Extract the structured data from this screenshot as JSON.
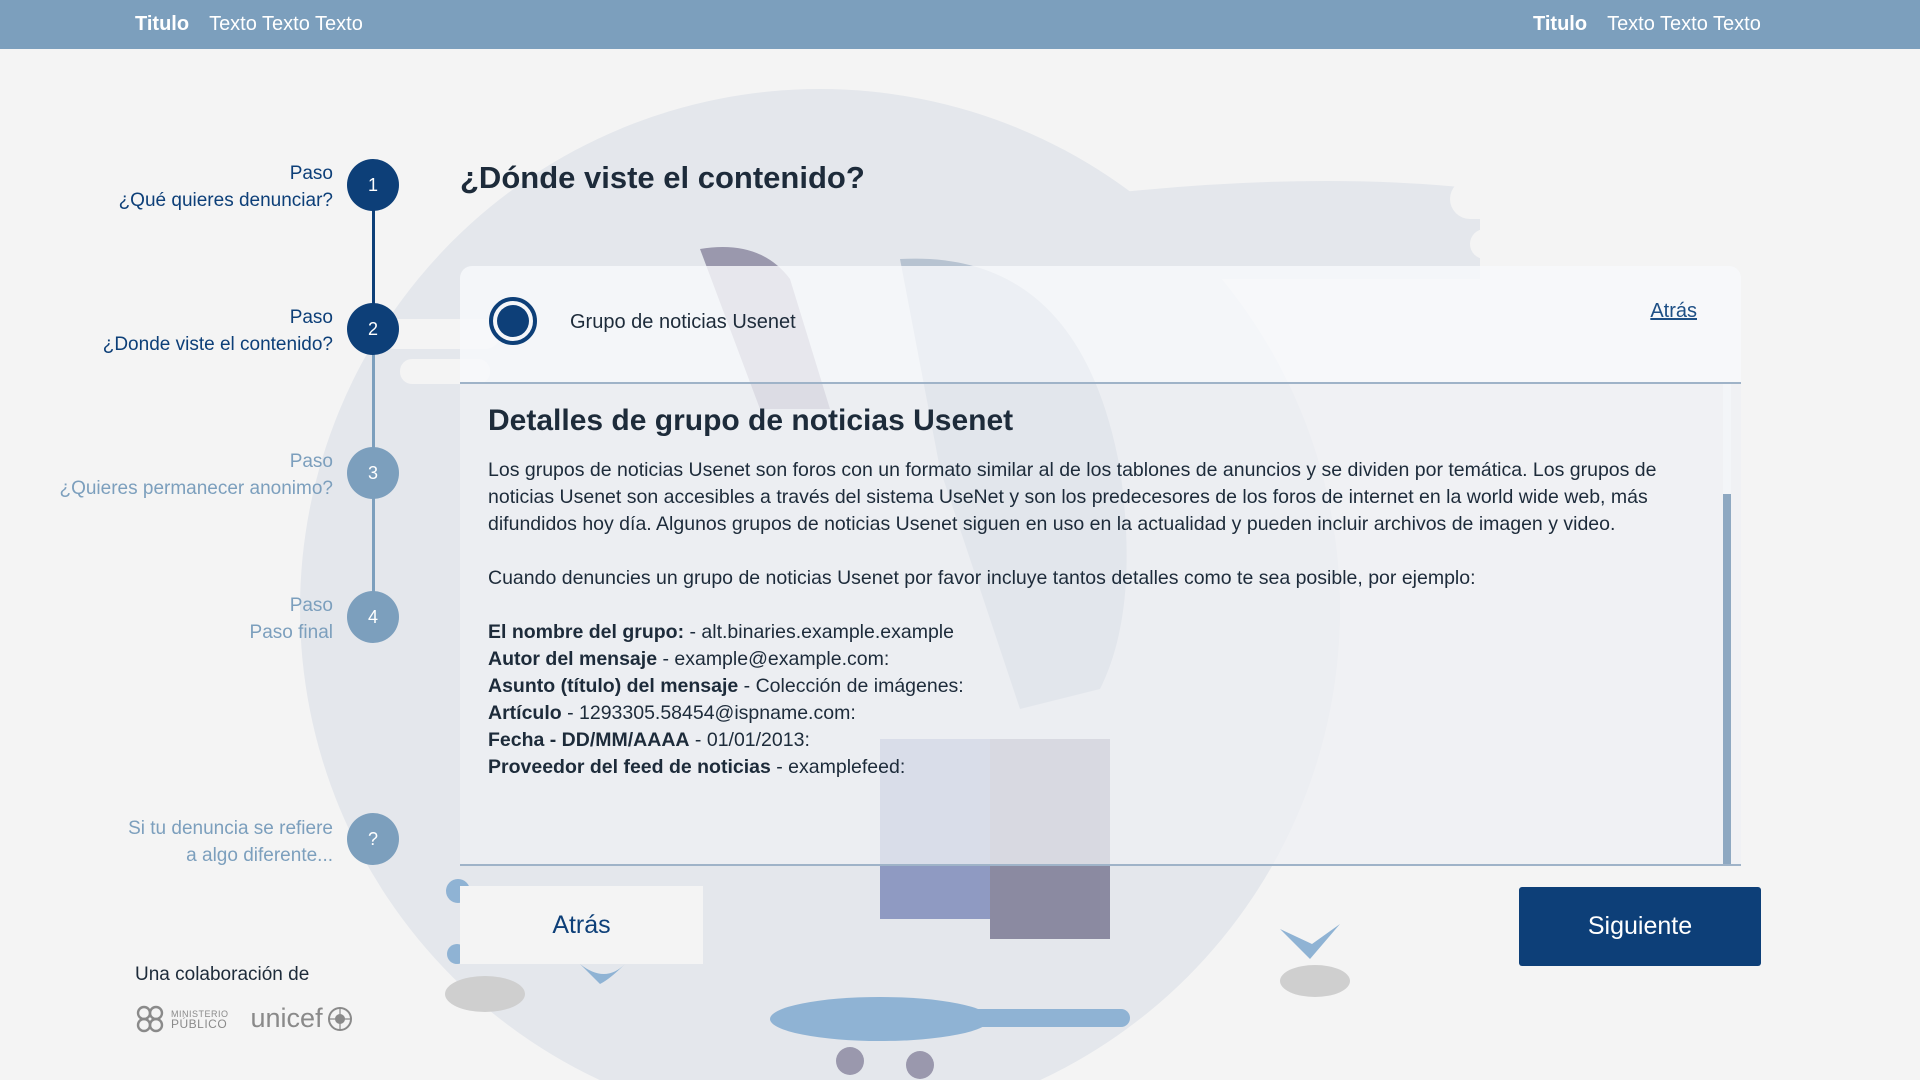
{
  "topbar": {
    "left": {
      "title": "Titulo",
      "text": "Texto Texto Texto"
    },
    "right": {
      "title": "Titulo",
      "text": "Texto Texto Texto"
    }
  },
  "steps": [
    {
      "label": "Paso",
      "name": "¿Qué quieres denunciar?",
      "number": "1",
      "state": "active"
    },
    {
      "label": "Paso",
      "name": "¿Donde viste el contenido?",
      "number": "2",
      "state": "active"
    },
    {
      "label": "Paso",
      "name": "¿Quieres permanecer anonimo?",
      "number": "3",
      "state": "inactive"
    },
    {
      "label": "Paso",
      "name": "Paso final",
      "number": "4",
      "state": "inactive"
    }
  ],
  "help_step": {
    "line1": "Si tu denuncia se refiere",
    "line2": "a algo diferente...",
    "symbol": "?"
  },
  "main": {
    "question": "¿Dónde viste el contenido?",
    "option": {
      "label": "Grupo de noticias Usenet",
      "selected": true,
      "back_link": "Atrás"
    },
    "details": {
      "title": "Detalles de grupo de noticias Usenet",
      "paragraph1": "Los grupos de noticias Usenet son foros con un formato similar al de los tablones de anuncios y se dividen por temática. Los grupos de noticias Usenet son accesibles a través del sistema UseNet y son los predecesores de los foros de internet en la world wide web, más difundidos hoy día. Algunos grupos de noticias Usenet siguen en uso en la actualidad y pueden incluir archivos de imagen y video.",
      "paragraph2": "Cuando denuncies un grupo de noticias Usenet por favor incluye tantos detalles como te sea posible, por ejemplo:",
      "fields": [
        {
          "key": "El nombre del grupo:",
          "value": " - alt.binaries.example.example"
        },
        {
          "key": "Autor del mensaje",
          "value": " - example@example.com:"
        },
        {
          "key": "Asunto (título) del mensaje",
          "value": " - Colección de imágenes:"
        },
        {
          "key": "Artículo",
          "value": " - 1293305.58454@ispname.com:"
        },
        {
          "key": "Fecha - DD/MM/AAAA",
          "value": " - 01/01/2013:"
        },
        {
          "key": "Proveedor del feed de noticias",
          "value": " - examplefeed:"
        }
      ]
    }
  },
  "buttons": {
    "back": "Atrás",
    "next": "Siguiente"
  },
  "footer": {
    "collab": "Una colaboración de",
    "logo1": [
      "MINISTERIO",
      "PÚBLICO"
    ],
    "logo2": "unicef"
  },
  "colors": {
    "primary": "#0d3f78",
    "secondary": "#7c9fbd",
    "background": "#f4f4f4"
  }
}
